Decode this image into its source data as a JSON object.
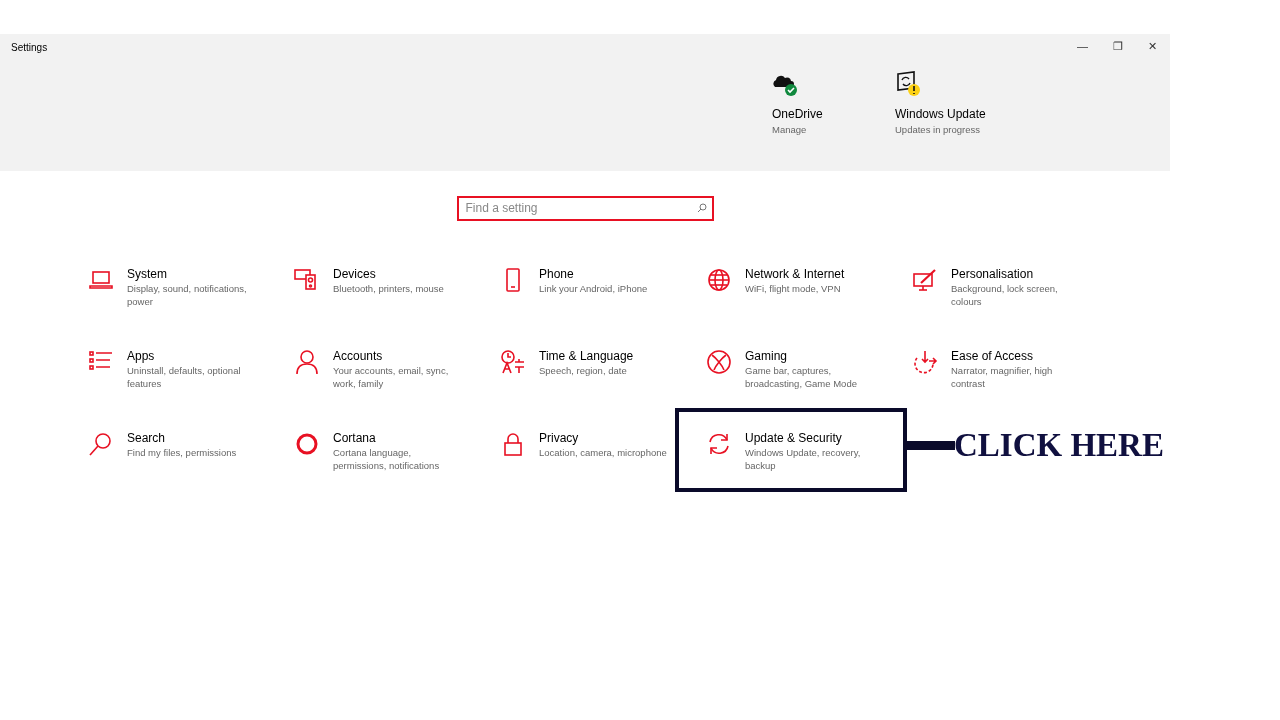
{
  "window": {
    "title": "Settings",
    "controls": [
      "—",
      "❐",
      "✕"
    ]
  },
  "header_items": [
    {
      "title": "OneDrive",
      "subtitle": "Manage",
      "color": "#10893e"
    },
    {
      "title": "Windows Update",
      "subtitle": "Updates in progress",
      "color": "#fcd116"
    }
  ],
  "search": {
    "placeholder": "Find a setting"
  },
  "categories": [
    {
      "title": "System",
      "description": "Display, sound, notifications, power",
      "highlighted": false
    },
    {
      "title": "Devices",
      "description": "Bluetooth, printers, mouse",
      "highlighted": false
    },
    {
      "title": "Phone",
      "description": "Link your Android, iPhone",
      "highlighted": false
    },
    {
      "title": "Network & Internet",
      "description": "WiFi, flight mode, VPN",
      "highlighted": false
    },
    {
      "title": "Personalisation",
      "description": "Background, lock screen, colours",
      "highlighted": false
    },
    {
      "title": "Apps",
      "description": "Uninstall, defaults, optional features",
      "highlighted": false
    },
    {
      "title": "Accounts",
      "description": "Your accounts, email, sync, work, family",
      "highlighted": false
    },
    {
      "title": "Time & Language",
      "description": "Speech, region, date",
      "highlighted": false
    },
    {
      "title": "Gaming",
      "description": "Game bar, captures, broadcasting, Game Mode",
      "highlighted": false
    },
    {
      "title": "Ease of Access",
      "description": "Narrator, magnifier, high contrast",
      "highlighted": false
    },
    {
      "title": "Search",
      "description": "Find my files, permissions",
      "highlighted": false
    },
    {
      "title": "Cortana",
      "description": "Cortana language, permissions, notifications",
      "highlighted": false
    },
    {
      "title": "Privacy",
      "description": "Location, camera, microphone",
      "highlighted": false
    },
    {
      "title": "Update & Security",
      "description": "Windows Update, recovery, backup",
      "highlighted": true,
      "callout": "CLICK HERE"
    }
  ]
}
